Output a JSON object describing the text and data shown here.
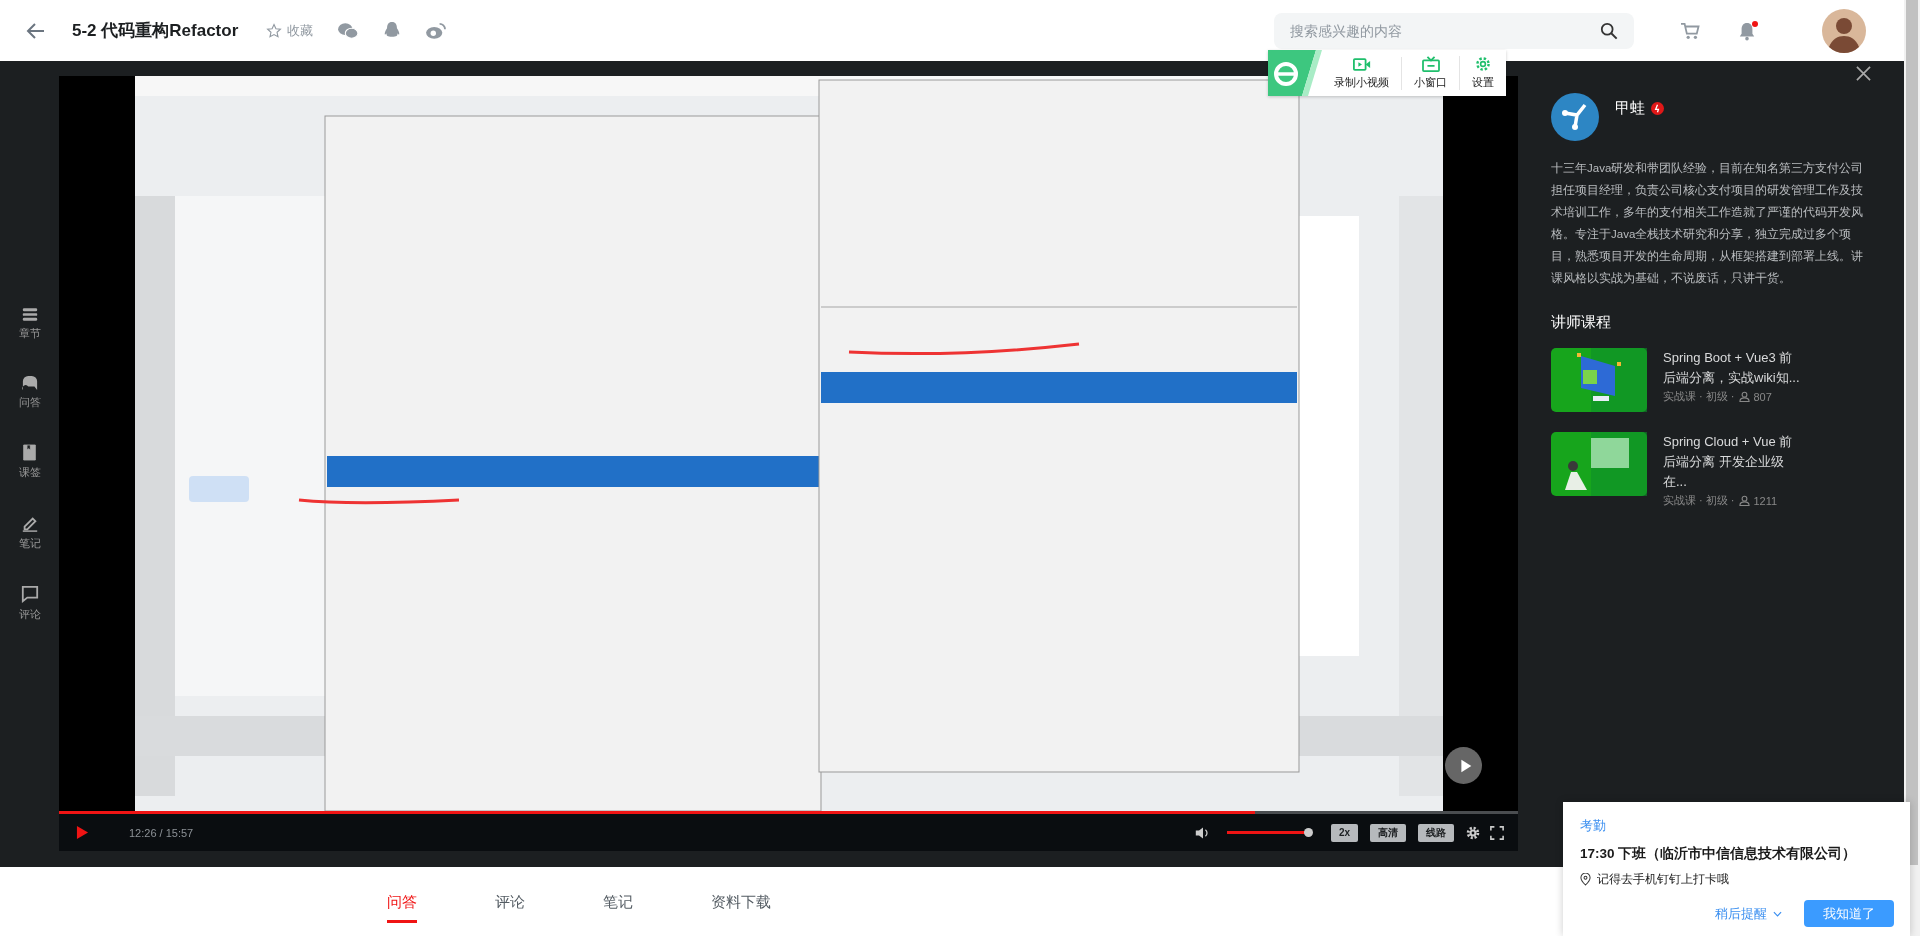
{
  "header": {
    "title": "5-2 代码重构Refactor",
    "favorite_label": "收藏",
    "search": {
      "placeholder": "搜索感兴趣的内容"
    },
    "has_unread": true
  },
  "browser_toolbar": {
    "buttons": [
      {
        "label": "录制小视频",
        "kind": "record"
      },
      {
        "label": "小窗口",
        "kind": "window"
      },
      {
        "label": "设置",
        "kind": "settings"
      }
    ]
  },
  "sidebar": {
    "items": [
      {
        "label": "章节",
        "kind": "chapters"
      },
      {
        "label": "问答",
        "kind": "qa"
      },
      {
        "label": "课签",
        "kind": "bookmark"
      },
      {
        "label": "笔记",
        "kind": "notes"
      },
      {
        "label": "评论",
        "kind": "comments"
      }
    ]
  },
  "player": {
    "video": {
      "kind": "picture"
    },
    "progress": {
      "level": 0.82
    },
    "time": "12:26 / 15:57",
    "volume": {
      "level": 1
    },
    "buttons": [
      "2x",
      "高清",
      "线路"
    ]
  },
  "teacher": {
    "name": "甲蛙",
    "bio": "十三年Java研发和带团队经验，目前在知名第三方支付公司担任项目经理，负责公司核心支付项目的研发管理工作及技术培训工作，多年的支付相关工作造就了严谨的代码开发风格。专注于Java全栈技术研究和分享，独立完成过多个项目，熟悉项目开发的生命周期，从框架搭建到部署上线。讲课风格以实战为基础，不说废话，只讲干货。",
    "courses_heading": "讲师课程",
    "courses": [
      {
        "title": "Spring Boot + Vue3 前后端分离，实战wiki知...",
        "meta": "实战课 · 初级 ·",
        "students": "807"
      },
      {
        "title": "Spring Cloud + Vue 前后端分离 开发企业级在...",
        "meta": "实战课 · 初级 ·",
        "students": "1211"
      }
    ]
  },
  "tabs": [
    {
      "label": "问答",
      "selected": true
    },
    {
      "label": "评论",
      "selected": false
    },
    {
      "label": "笔记",
      "selected": false
    },
    {
      "label": "资料下载",
      "selected": false
    }
  ],
  "notification": {
    "category": "考勤",
    "title": "17:30 下班（临沂市中信信息技术有限公司）",
    "message": "记得去手机钉钉上打卡哦",
    "snooze_label": "稍后提醒",
    "confirm_label": "我知道了"
  }
}
